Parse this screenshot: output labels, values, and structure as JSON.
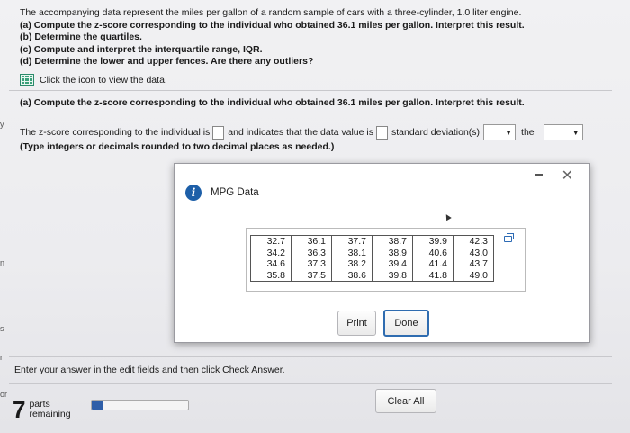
{
  "problem": {
    "lead": "The accompanying data represent the miles per gallon of a random sample of cars with a three-cylinder, 1.0 liter engine.",
    "parts": [
      "(a) Compute the z-score corresponding to the individual who obtained 36.1 miles per gallon. Interpret this result.",
      "(b) Determine the quartiles.",
      "(c) Compute and interpret the interquartile range, IQR.",
      "(d) Determine the lower and upper fences. Are there any outliers?"
    ],
    "data_link": "Click the icon to view the data."
  },
  "edge_fragments": [
    "y",
    "n",
    "s",
    "r",
    "or"
  ],
  "section": {
    "title": "(a) Compute the z-score corresponding to the individual who obtained 36.1 miles per gallon. Interpret this result.",
    "sentence_part1": "The z-score corresponding to the individual is",
    "sentence_part2": "and indicates that the data value is",
    "sentence_part3": "standard deviation(s)",
    "sentence_part4": "the",
    "hint": "(Type integers or decimals rounded to two decimal places as needed.)"
  },
  "dialog": {
    "title": "MPG Data",
    "table": [
      [
        "32.7",
        "36.1",
        "37.7",
        "38.7",
        "39.9",
        "42.3"
      ],
      [
        "34.2",
        "36.3",
        "38.1",
        "38.9",
        "40.6",
        "43.0"
      ],
      [
        "34.6",
        "37.3",
        "38.2",
        "39.4",
        "41.4",
        "43.7"
      ],
      [
        "35.8",
        "37.5",
        "38.6",
        "39.8",
        "41.8",
        "49.0"
      ]
    ],
    "print_label": "Print",
    "done_label": "Done"
  },
  "footer": {
    "instructions": "Enter your answer in the edit fields and then click Check Answer.",
    "parts_count": "7",
    "parts_label_1": "parts",
    "parts_label_2": "remaining",
    "progress_fraction": 0.12,
    "clear_all_label": "Clear All"
  },
  "colors": {
    "accent": "#2f6cb0",
    "info_icon": "#1d5fa8",
    "data_icon": "#3aa07a"
  }
}
